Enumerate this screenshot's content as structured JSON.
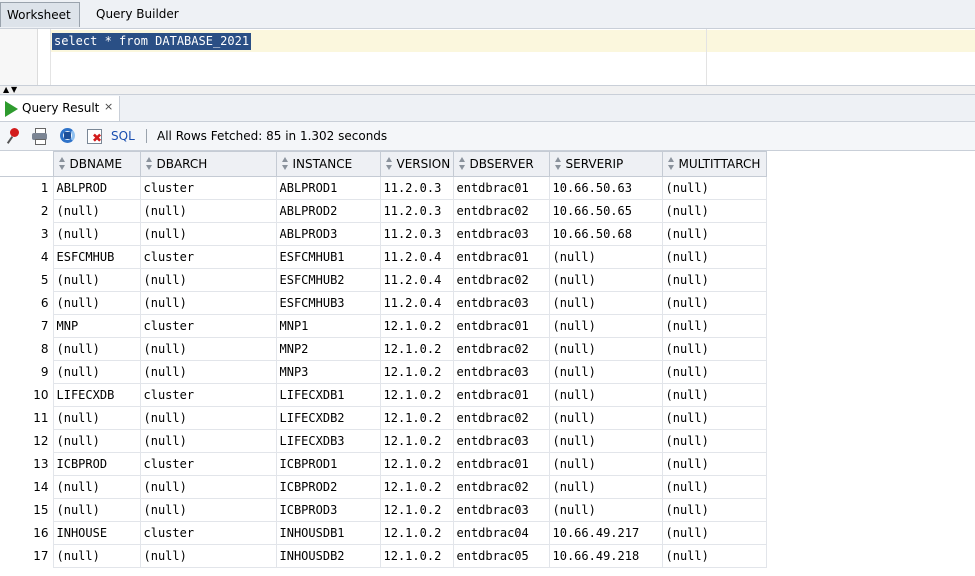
{
  "worksheet_tabs": [
    "Worksheet",
    "Query Builder"
  ],
  "editor": {
    "sql": "select * from DATABASE_2021"
  },
  "result_tab": {
    "label": "Query Result",
    "close": "×"
  },
  "toolbar": {
    "sql_label": "SQL",
    "status": "All Rows Fetched: 85 in 1.302 seconds"
  },
  "table": {
    "columns": [
      "DBNAME",
      "DBARCH",
      "INSTANCE",
      "VERSION",
      "DBSERVER",
      "SERVERIP",
      "MULTITTARCH"
    ],
    "rows": [
      [
        "1",
        "ABLPROD",
        "cluster",
        "ABLPROD1",
        "11.2.0.3",
        "entdbrac01",
        "10.66.50.63",
        "(null)"
      ],
      [
        "2",
        "(null)",
        "(null)",
        "ABLPROD2",
        "11.2.0.3",
        "entdbrac02",
        "10.66.50.65",
        "(null)"
      ],
      [
        "3",
        "(null)",
        "(null)",
        "ABLPROD3",
        "11.2.0.3",
        "entdbrac03",
        "10.66.50.68",
        "(null)"
      ],
      [
        "4",
        "ESFCMHUB",
        "cluster",
        "ESFCMHUB1",
        "11.2.0.4",
        "entdbrac01",
        "(null)",
        "(null)"
      ],
      [
        "5",
        "(null)",
        "(null)",
        "ESFCMHUB2",
        "11.2.0.4",
        "entdbrac02",
        "(null)",
        "(null)"
      ],
      [
        "6",
        "(null)",
        "(null)",
        "ESFCMHUB3",
        "11.2.0.4",
        "entdbrac03",
        "(null)",
        "(null)"
      ],
      [
        "7",
        "MNP",
        "cluster",
        "MNP1",
        "12.1.0.2",
        "entdbrac01",
        "(null)",
        "(null)"
      ],
      [
        "8",
        "(null)",
        "(null)",
        "MNP2",
        "12.1.0.2",
        "entdbrac02",
        "(null)",
        "(null)"
      ],
      [
        "9",
        "(null)",
        "(null)",
        "MNP3",
        "12.1.0.2",
        "entdbrac03",
        "(null)",
        "(null)"
      ],
      [
        "10",
        "LIFECXDB",
        "cluster",
        "LIFECXDB1",
        "12.1.0.2",
        "entdbrac01",
        "(null)",
        "(null)"
      ],
      [
        "11",
        "(null)",
        "(null)",
        "LIFECXDB2",
        "12.1.0.2",
        "entdbrac02",
        "(null)",
        "(null)"
      ],
      [
        "12",
        "(null)",
        "(null)",
        "LIFECXDB3",
        "12.1.0.2",
        "entdbrac03",
        "(null)",
        "(null)"
      ],
      [
        "13",
        "ICBPROD",
        "cluster",
        "ICBPROD1",
        "12.1.0.2",
        "entdbrac01",
        "(null)",
        "(null)"
      ],
      [
        "14",
        "(null)",
        "(null)",
        "ICBPROD2",
        "12.1.0.2",
        "entdbrac02",
        "(null)",
        "(null)"
      ],
      [
        "15",
        "(null)",
        "(null)",
        "ICBPROD3",
        "12.1.0.2",
        "entdbrac03",
        "(null)",
        "(null)"
      ],
      [
        "16",
        "INHOUSE",
        "cluster",
        "INHOUSDB1",
        "12.1.0.2",
        "entdbrac04",
        "10.66.49.217",
        "(null)"
      ],
      [
        "17",
        "(null)",
        "(null)",
        "INHOUSDB2",
        "12.1.0.2",
        "entdbrac05",
        "10.66.49.218",
        "(null)"
      ]
    ]
  }
}
